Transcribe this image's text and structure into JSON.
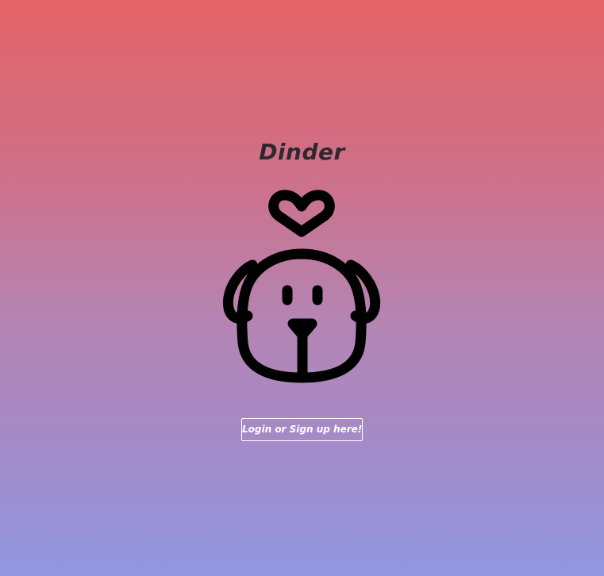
{
  "app": {
    "title": "Dinder"
  },
  "logo": {
    "icon": "dog-with-heart-icon",
    "color": "#000000"
  },
  "login": {
    "label": "Login or Sign up here!"
  },
  "theme": {
    "gradient_top": "#e56468",
    "gradient_bottom": "#9197e2",
    "title_color": "#2e2930",
    "button_color": "#ffffff"
  }
}
